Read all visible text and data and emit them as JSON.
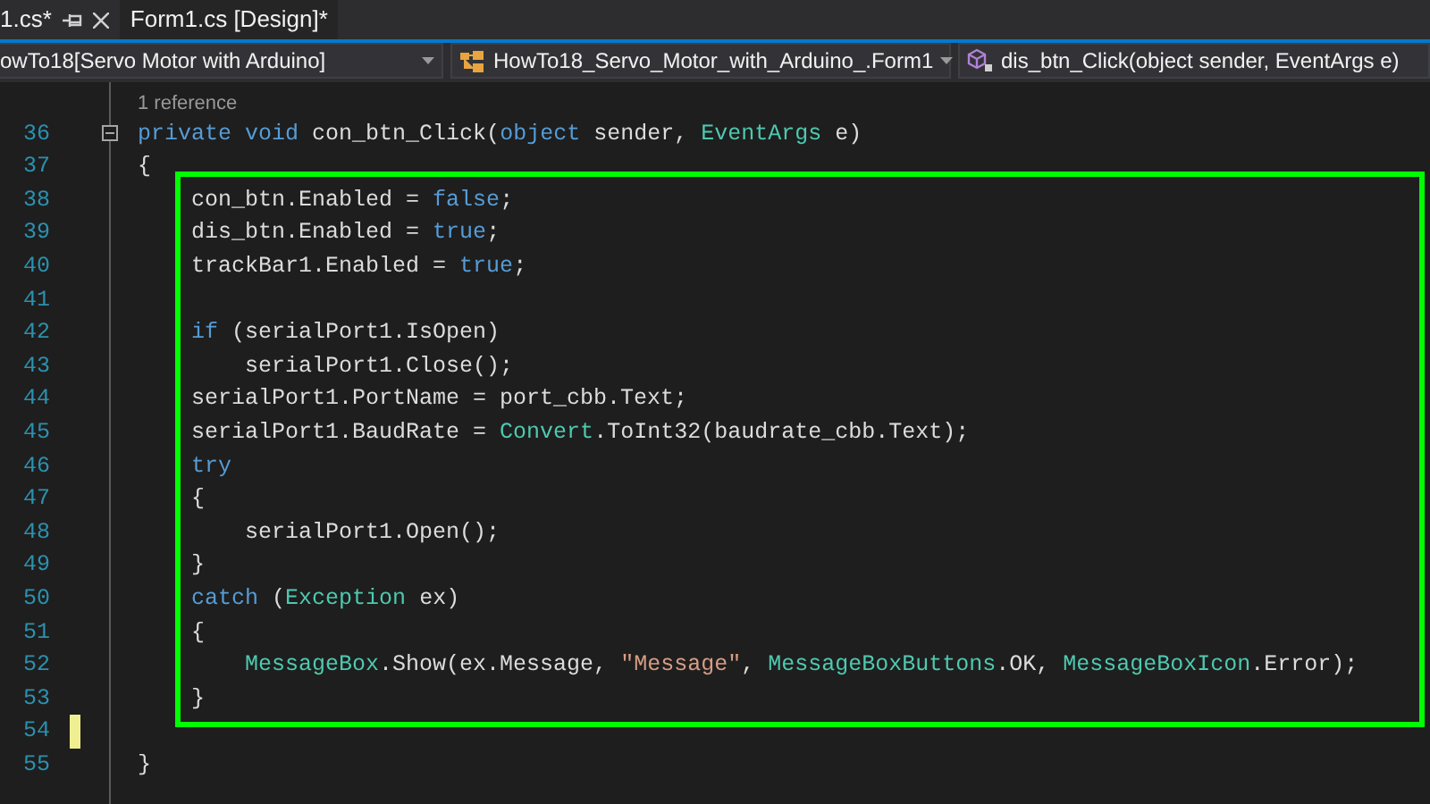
{
  "tabs": [
    {
      "label": "1.cs*",
      "selected": true
    },
    {
      "label": "Form1.cs [Design]*",
      "selected": false
    }
  ],
  "nav_bar": [
    {
      "text": "owTo18[Servo Motor with Arduino]"
    },
    {
      "text": "HowTo18_Servo_Motor_with_Arduino_.Form1"
    },
    {
      "text": "dis_btn_Click(object sender, EventArgs e)"
    }
  ],
  "editor": {
    "lines": [
      {
        "number": "36",
        "codelens": "1 reference",
        "collapsible": true,
        "changed": false,
        "in_frame": false,
        "tokens": [
          {
            "text": "private",
            "kind": "keyword"
          },
          {
            "text": " void",
            "kind": "keyword"
          },
          {
            "text": " con_btn_Click(",
            "kind": "plain"
          },
          {
            "text": "object",
            "kind": "keyword"
          },
          {
            "text": " sender, ",
            "kind": "plain"
          },
          {
            "text": "EventArgs",
            "kind": "type"
          },
          {
            "text": " e)",
            "kind": "plain"
          }
        ]
      },
      {
        "number": "37",
        "collapsible": false,
        "changed": false,
        "in_frame": false,
        "tokens": [
          {
            "text": "{",
            "kind": "plain"
          }
        ]
      },
      {
        "number": "38",
        "collapsible": false,
        "changed": false,
        "in_frame": true,
        "tokens": [
          {
            "text": "    con_btn.Enabled = ",
            "kind": "plain"
          },
          {
            "text": "false",
            "kind": "keyword"
          },
          {
            "text": ";",
            "kind": "plain"
          }
        ]
      },
      {
        "number": "39",
        "collapsible": false,
        "changed": false,
        "in_frame": true,
        "tokens": [
          {
            "text": "    dis_btn.Enabled = ",
            "kind": "plain"
          },
          {
            "text": "true",
            "kind": "keyword"
          },
          {
            "text": ";",
            "kind": "plain"
          }
        ]
      },
      {
        "number": "40",
        "collapsible": false,
        "changed": false,
        "in_frame": true,
        "tokens": [
          {
            "text": "    trackBar1.Enabled = ",
            "kind": "plain"
          },
          {
            "text": "true",
            "kind": "keyword"
          },
          {
            "text": ";",
            "kind": "plain"
          }
        ]
      },
      {
        "number": "41",
        "collapsible": false,
        "changed": false,
        "in_frame": true
      },
      {
        "number": "42",
        "collapsible": false,
        "changed": false,
        "in_frame": true,
        "tokens": [
          {
            "text": "    if",
            "kind": "keyword"
          },
          {
            "text": " (serialPort1.IsOpen)",
            "kind": "plain"
          }
        ]
      },
      {
        "number": "43",
        "collapsible": false,
        "changed": false,
        "in_frame": true,
        "tokens": [
          {
            "text": "        serialPort1.Close();",
            "kind": "plain"
          }
        ]
      },
      {
        "number": "44",
        "collapsible": false,
        "changed": false,
        "in_frame": true,
        "tokens": [
          {
            "text": "    serialPort1.PortName = port_cbb.Text;",
            "kind": "plain"
          }
        ]
      },
      {
        "number": "45",
        "collapsible": false,
        "changed": false,
        "in_frame": true,
        "tokens": [
          {
            "text": "    serialPort1.BaudRate = ",
            "kind": "plain"
          },
          {
            "text": "Convert",
            "kind": "type"
          },
          {
            "text": ".ToInt32(baudrate_cbb.Text);",
            "kind": "plain"
          }
        ]
      },
      {
        "number": "46",
        "collapsible": false,
        "changed": false,
        "in_frame": true,
        "tokens": [
          {
            "text": "    try",
            "kind": "keyword"
          }
        ]
      },
      {
        "number": "47",
        "collapsible": false,
        "changed": false,
        "in_frame": true,
        "tokens": [
          {
            "text": "    {",
            "kind": "plain"
          }
        ]
      },
      {
        "number": "48",
        "collapsible": false,
        "changed": false,
        "in_frame": true,
        "tokens": [
          {
            "text": "        serialPort1.Open();",
            "kind": "plain"
          }
        ]
      },
      {
        "number": "49",
        "collapsible": false,
        "changed": false,
        "in_frame": true,
        "tokens": [
          {
            "text": "    }",
            "kind": "plain"
          }
        ]
      },
      {
        "number": "50",
        "collapsible": false,
        "changed": false,
        "in_frame": true,
        "tokens": [
          {
            "text": "    catch",
            "kind": "keyword"
          },
          {
            "text": " (",
            "kind": "plain"
          },
          {
            "text": "Exception",
            "kind": "type"
          },
          {
            "text": " ex)",
            "kind": "plain"
          }
        ]
      },
      {
        "number": "51",
        "collapsible": false,
        "changed": false,
        "in_frame": true,
        "tokens": [
          {
            "text": "    {",
            "kind": "plain"
          }
        ]
      },
      {
        "number": "52",
        "collapsible": false,
        "changed": false,
        "in_frame": true,
        "tokens": [
          {
            "text": "        MessageBox",
            "kind": "type"
          },
          {
            "text": ".Show(ex.Message, ",
            "kind": "plain"
          },
          {
            "text": "\"Message\"",
            "kind": "string"
          },
          {
            "text": ", ",
            "kind": "plain"
          },
          {
            "text": "MessageBoxButtons",
            "kind": "type"
          },
          {
            "text": ".OK, ",
            "kind": "plain"
          },
          {
            "text": "MessageBoxIcon",
            "kind": "type"
          },
          {
            "text": ".Error);",
            "kind": "plain"
          }
        ]
      },
      {
        "number": "53",
        "collapsible": false,
        "changed": false,
        "in_frame": true,
        "tokens": [
          {
            "text": "    }",
            "kind": "plain"
          }
        ]
      },
      {
        "number": "54",
        "collapsible": false,
        "changed": true,
        "in_frame": false
      },
      {
        "number": "55",
        "collapsible": false,
        "changed": false,
        "in_frame": false,
        "tokens": [
          {
            "text": "}",
            "kind": "plain"
          }
        ]
      }
    ]
  }
}
